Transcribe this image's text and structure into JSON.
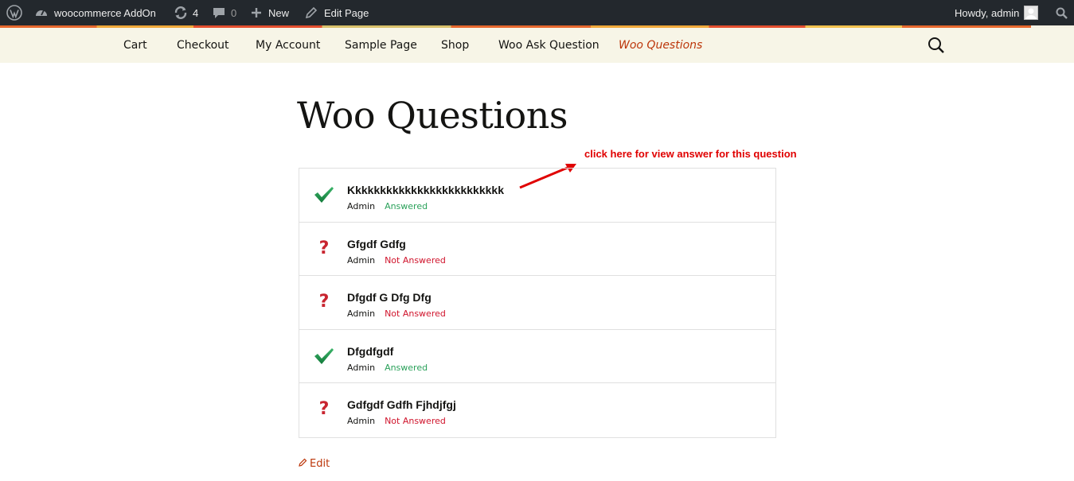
{
  "adminbar": {
    "site_name": "woocommerce AddOn",
    "updates_count": "4",
    "comments_count": "0",
    "new_label": "New",
    "edit_page_label": "Edit Page",
    "howdy_label": "Howdy, admin"
  },
  "nav": {
    "items": [
      {
        "label": "Cart"
      },
      {
        "label": "Checkout"
      },
      {
        "label": "My Account"
      },
      {
        "label": "Sample Page"
      },
      {
        "label": "Shop"
      },
      {
        "label": "Woo Ask Question"
      },
      {
        "label": "Woo Questions",
        "active": true
      }
    ]
  },
  "page": {
    "title": "Woo Questions",
    "annotation": "click here for view answer for this question",
    "edit_label": "Edit"
  },
  "questions": [
    {
      "title": "Kkkkkkkkkkkkkkkkkkkkkkkkk",
      "author": "Admin",
      "status": "Answered",
      "icon": "check-icon"
    },
    {
      "title": "Gfgdf Gdfg",
      "author": "Admin",
      "status": "Not Answered",
      "icon": "question-mark-icon"
    },
    {
      "title": "Dfgdf G Dfg Dfg",
      "author": "Admin",
      "status": "Not Answered",
      "icon": "question-mark-icon"
    },
    {
      "title": "Dfgdfgdf",
      "author": "Admin",
      "status": "Answered",
      "icon": "check-icon"
    },
    {
      "title": "Gdfgdf Gdfh Fjhdjfgj",
      "author": "Admin",
      "status": "Not Answered",
      "icon": "question-mark-icon"
    }
  ],
  "colors": {
    "adminbar_bg": "#23282d",
    "nav_bg": "#f7f5e7",
    "accent": "#bc360a",
    "answered": "#2aa15a",
    "not_answered": "#d0142c",
    "annotation": "#e00000"
  }
}
